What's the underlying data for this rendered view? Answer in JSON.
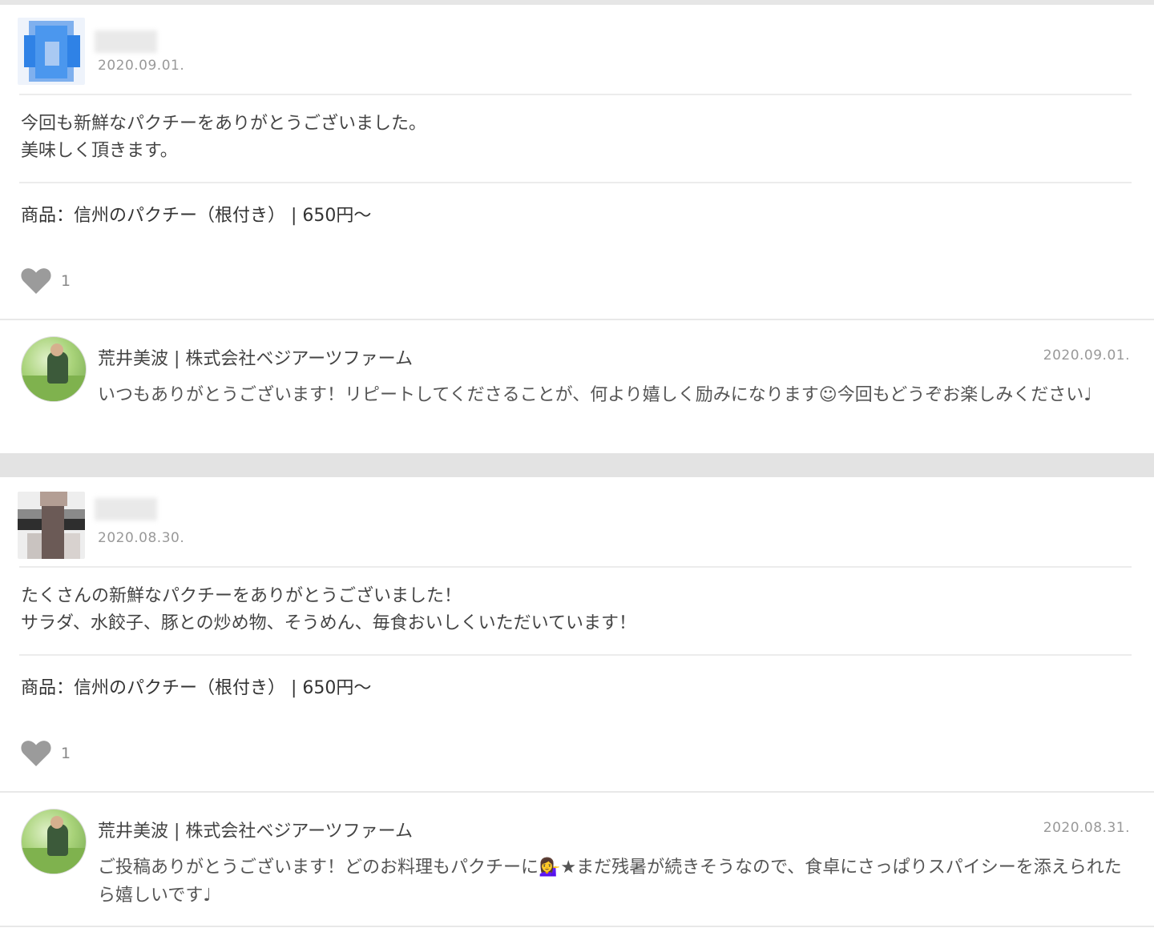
{
  "reviews": [
    {
      "avatar_icon": "blurred-user-avatar-blue",
      "date": "2020.09.01.",
      "body_lines": [
        "今回も新鮮なパクチーをありがとうございました。",
        "美味しく頂きます。"
      ],
      "product": "商品：信州のパクチー（根付き） | 650円～",
      "likes": "1",
      "reply": {
        "author": "荒井美波 | 株式会社ベジアーツファーム",
        "date": "2020.09.01.",
        "text": "いつもありがとうございます！リピートしてくださることが、何より嬉しく励みになります☺今回もどうぞお楽しみください♩"
      }
    },
    {
      "avatar_icon": "blurred-user-avatar-dark",
      "date": "2020.08.30.",
      "body_lines": [
        "たくさんの新鮮なパクチーをありがとうございました！",
        "サラダ、水餃子、豚との炒め物、そうめん、毎食おいしくいただいています！"
      ],
      "product": "商品：信州のパクチー（根付き） | 650円～",
      "likes": "1",
      "reply": {
        "author": "荒井美波 | 株式会社ベジアーツファーム",
        "date": "2020.08.31.",
        "text": "ご投稿ありがとうございます！どのお料理もパクチーに💁‍♀️★まだ残暑が続きそうなので、食卓にさっぱりスパイシーを添えられたら嬉しいです♩"
      }
    }
  ],
  "colors": {
    "heart": "#9b9b9b",
    "divider": "#ececec",
    "band": "#e3e3e3"
  }
}
